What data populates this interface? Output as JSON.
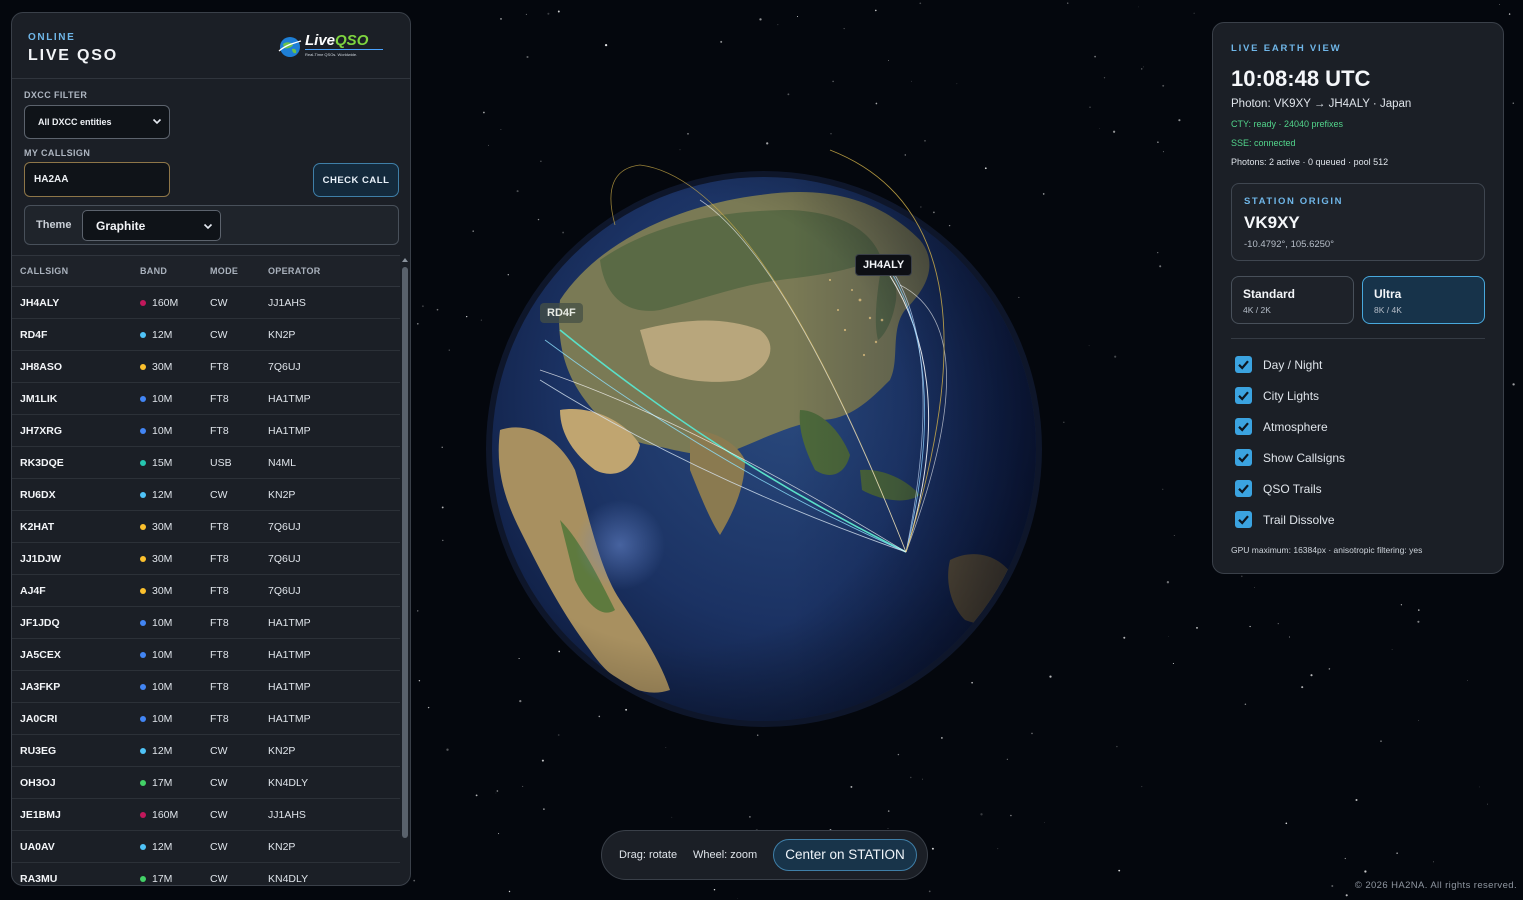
{
  "header": {
    "status": "ONLINE",
    "title": "LIVE QSO",
    "logo_main": "Live",
    "logo_accent": "QSO",
    "logo_tagline": "Real-Time QSOs. Worldwide."
  },
  "filters": {
    "dxcc_label": "DXCC FILTER",
    "dxcc_value": "All DXCC entities",
    "callsign_label": "MY CALLSIGN",
    "callsign_value": "HA2AA",
    "check_button": "CHECK CALL",
    "theme_label": "Theme",
    "theme_value": "Graphite"
  },
  "table": {
    "columns": [
      "CALLSIGN",
      "BAND",
      "MODE",
      "OPERATOR"
    ],
    "band_colors": {
      "160M": "#c2185b",
      "12M": "#4fc3f7",
      "30M": "#fbc02d",
      "10M": "#4285f4",
      "15M": "#26c6b0",
      "17M": "#43d167"
    },
    "rows": [
      {
        "call": "JH4ALY",
        "band": "160M",
        "mode": "CW",
        "op": "JJ1AHS"
      },
      {
        "call": "RD4F",
        "band": "12M",
        "mode": "CW",
        "op": "KN2P"
      },
      {
        "call": "JH8ASO",
        "band": "30M",
        "mode": "FT8",
        "op": "7Q6UJ"
      },
      {
        "call": "JM1LIK",
        "band": "10M",
        "mode": "FT8",
        "op": "HA1TMP"
      },
      {
        "call": "JH7XRG",
        "band": "10M",
        "mode": "FT8",
        "op": "HA1TMP"
      },
      {
        "call": "RK3DQE",
        "band": "15M",
        "mode": "USB",
        "op": "N4ML"
      },
      {
        "call": "RU6DX",
        "band": "12M",
        "mode": "CW",
        "op": "KN2P"
      },
      {
        "call": "K2HAT",
        "band": "30M",
        "mode": "FT8",
        "op": "7Q6UJ"
      },
      {
        "call": "JJ1DJW",
        "band": "30M",
        "mode": "FT8",
        "op": "7Q6UJ"
      },
      {
        "call": "AJ4F",
        "band": "30M",
        "mode": "FT8",
        "op": "7Q6UJ"
      },
      {
        "call": "JF1JDQ",
        "band": "10M",
        "mode": "FT8",
        "op": "HA1TMP"
      },
      {
        "call": "JA5CEX",
        "band": "10M",
        "mode": "FT8",
        "op": "HA1TMP"
      },
      {
        "call": "JA3FKP",
        "band": "10M",
        "mode": "FT8",
        "op": "HA1TMP"
      },
      {
        "call": "JA0CRI",
        "band": "10M",
        "mode": "FT8",
        "op": "HA1TMP"
      },
      {
        "call": "RU3EG",
        "band": "12M",
        "mode": "CW",
        "op": "KN2P"
      },
      {
        "call": "OH3OJ",
        "band": "17M",
        "mode": "CW",
        "op": "KN4DLY"
      },
      {
        "call": "JE1BMJ",
        "band": "160M",
        "mode": "CW",
        "op": "JJ1AHS"
      },
      {
        "call": "UA0AV",
        "band": "12M",
        "mode": "CW",
        "op": "KN2P"
      },
      {
        "call": "RA3MU",
        "band": "17M",
        "mode": "CW",
        "op": "KN4DLY"
      }
    ]
  },
  "earth_view": {
    "eyebrow": "LIVE EARTH VIEW",
    "time": "10:08:48 UTC",
    "photon": "Photon: VK9XY → JH4ALY · Japan",
    "cty": "CTY: ready · 24040 prefixes",
    "sse": "SSE: connected",
    "photons_status": "Photons: 2 active · 0 queued · pool 512",
    "station_label": "STATION ORIGIN",
    "station_call": "VK9XY",
    "station_coords": "-10.4792°, 105.6250°",
    "quality": [
      {
        "name": "Standard",
        "sub": "4K / 2K",
        "selected": false
      },
      {
        "name": "Ultra",
        "sub": "8K / 4K",
        "selected": true
      }
    ],
    "toggles": [
      {
        "label": "Day / Night",
        "checked": true
      },
      {
        "label": "City Lights",
        "checked": true
      },
      {
        "label": "Atmosphere",
        "checked": true
      },
      {
        "label": "Show Callsigns",
        "checked": true
      },
      {
        "label": "QSO Trails",
        "checked": true
      },
      {
        "label": "Trail Dissolve",
        "checked": true
      }
    ],
    "gpu": "GPU maximum: 16384px · anisotropic filtering: yes"
  },
  "globe": {
    "labels": [
      {
        "text": "JH4ALY"
      },
      {
        "text": "RD4F"
      }
    ]
  },
  "toolbar": {
    "drag_hint": "Drag: rotate",
    "wheel_hint": "Wheel: zoom",
    "center_button": "Center on STATION"
  },
  "footer": {
    "copyright": "© 2026 HA2NA. All rights reserved."
  },
  "colors": {
    "accent": "#3ba3e0",
    "eyebrow": "#6fb6e8",
    "status_green": "#52d48b",
    "panel_bg": "#1b1f26"
  }
}
